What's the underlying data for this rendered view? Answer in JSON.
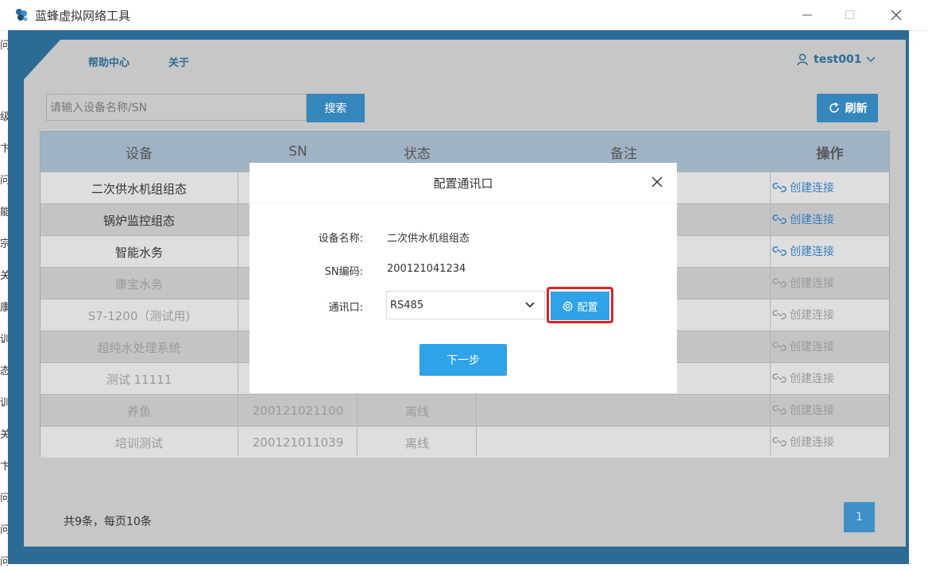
{
  "window": {
    "title": "蓝蜂虚拟网络工具",
    "controls": {
      "minimize": "—",
      "maximize": "☐",
      "close": "✕"
    }
  },
  "nav": {
    "help": "帮助中心",
    "about": "关于",
    "user": "test001"
  },
  "search": {
    "placeholder": "请输入设备名称/SN",
    "button": "搜索",
    "refresh": "刷新"
  },
  "table": {
    "headers": [
      "设备",
      "SN",
      "状态",
      "备注",
      "操作"
    ],
    "rows": [
      {
        "device": "二次供水机组组态",
        "sn": "",
        "status": "",
        "note": "",
        "action": "创建连接",
        "active": true
      },
      {
        "device": "锅炉监控组态",
        "sn": "",
        "status": "",
        "note": "",
        "action": "创建连接",
        "active": true
      },
      {
        "device": "智能水务",
        "sn": "",
        "status": "",
        "note": "",
        "action": "创建连接",
        "active": true
      },
      {
        "device": "康宝水务",
        "sn": "",
        "status": "",
        "note": "",
        "action": "创建连接",
        "active": false
      },
      {
        "device": "S7-1200（测试用)",
        "sn": "",
        "status": "",
        "note": "",
        "action": "创建连接",
        "active": false
      },
      {
        "device": "超纯水处理系统",
        "sn": "",
        "status": "",
        "note": "",
        "action": "创建连接",
        "active": false
      },
      {
        "device": "测试 11111",
        "sn": "",
        "status": "",
        "note": "",
        "action": "创建连接",
        "active": false
      },
      {
        "device": "养鱼",
        "sn": "200121021100",
        "status": "离线",
        "note": "",
        "action": "创建连接",
        "active": false
      },
      {
        "device": "培训测试",
        "sn": "200121011039",
        "status": "离线",
        "note": "",
        "action": "创建连接",
        "active": false
      }
    ]
  },
  "footer": {
    "summary": "共9条，每页10条",
    "page": "1"
  },
  "modal": {
    "title": "配置通讯口",
    "device_label": "设备名称:",
    "device_value": "二次供水机组组态",
    "sn_label": "SN编码:",
    "sn_value": "200121041234",
    "port_label": "通讯口:",
    "port_value": "RS485",
    "config_button": "配置",
    "next_button": "下一步"
  },
  "colors": {
    "frame": "#2c6b93",
    "accent": "#2ea3e8",
    "highlight": "#e02020",
    "link": "#3a7dc0"
  }
}
